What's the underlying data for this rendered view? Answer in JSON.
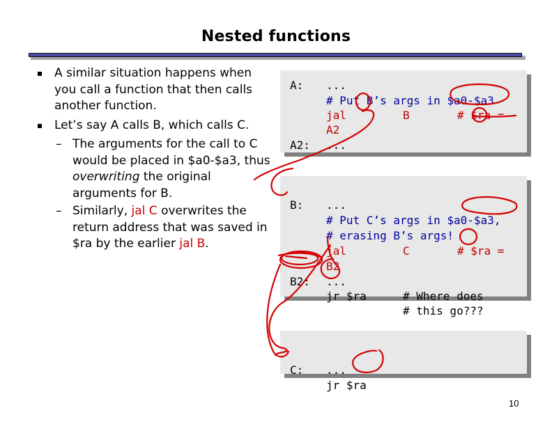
{
  "slide": {
    "title": "Nested functions",
    "page_number": "10",
    "colors": {
      "accent_rule": "#4a4aa6",
      "code_keyword": "#c00000",
      "code_comment": "#00009c",
      "ink": "#d40000",
      "box_bg": "#e8e8e8"
    }
  },
  "bullets": [
    {
      "level": 1,
      "text": "A similar situation happens when you call a function that then calls another function."
    },
    {
      "level": 1,
      "text": "Let’s say A calls B, which calls C."
    },
    {
      "level": 2,
      "parts": [
        "The arguments for the call to C would be placed in $a0-$a3, thus ",
        "overwriting",
        " the original arguments for B."
      ]
    },
    {
      "level": 2,
      "parts": [
        "Similarly, ",
        "jal C",
        " overwrites the return address that was saved in $ra by the earlier ",
        "jal B",
        "."
      ]
    }
  ],
  "code": {
    "a": {
      "label": "A:",
      "lines": [
        "...",
        "# Put B’s args in $a0-$a3",
        "jal",
        "B",
        "# $ra =",
        "A2"
      ],
      "label2": "A2:",
      "after": "..."
    },
    "b": {
      "label": "B:",
      "lines": [
        "...",
        "# Put C’s args in $a0-$a3,",
        "# erasing B’s args!",
        "jal",
        "C",
        "# $ra =",
        "B2"
      ],
      "label2": "B2:",
      "after": [
        "...",
        "jr $ra",
        "# Where does",
        "# this go???"
      ]
    },
    "c": {
      "label": "C:",
      "lines": [
        "...",
        "jr $ra"
      ]
    }
  },
  "annotations": {
    "description": "Red freehand ink circles and arrows drawn over the code"
  }
}
